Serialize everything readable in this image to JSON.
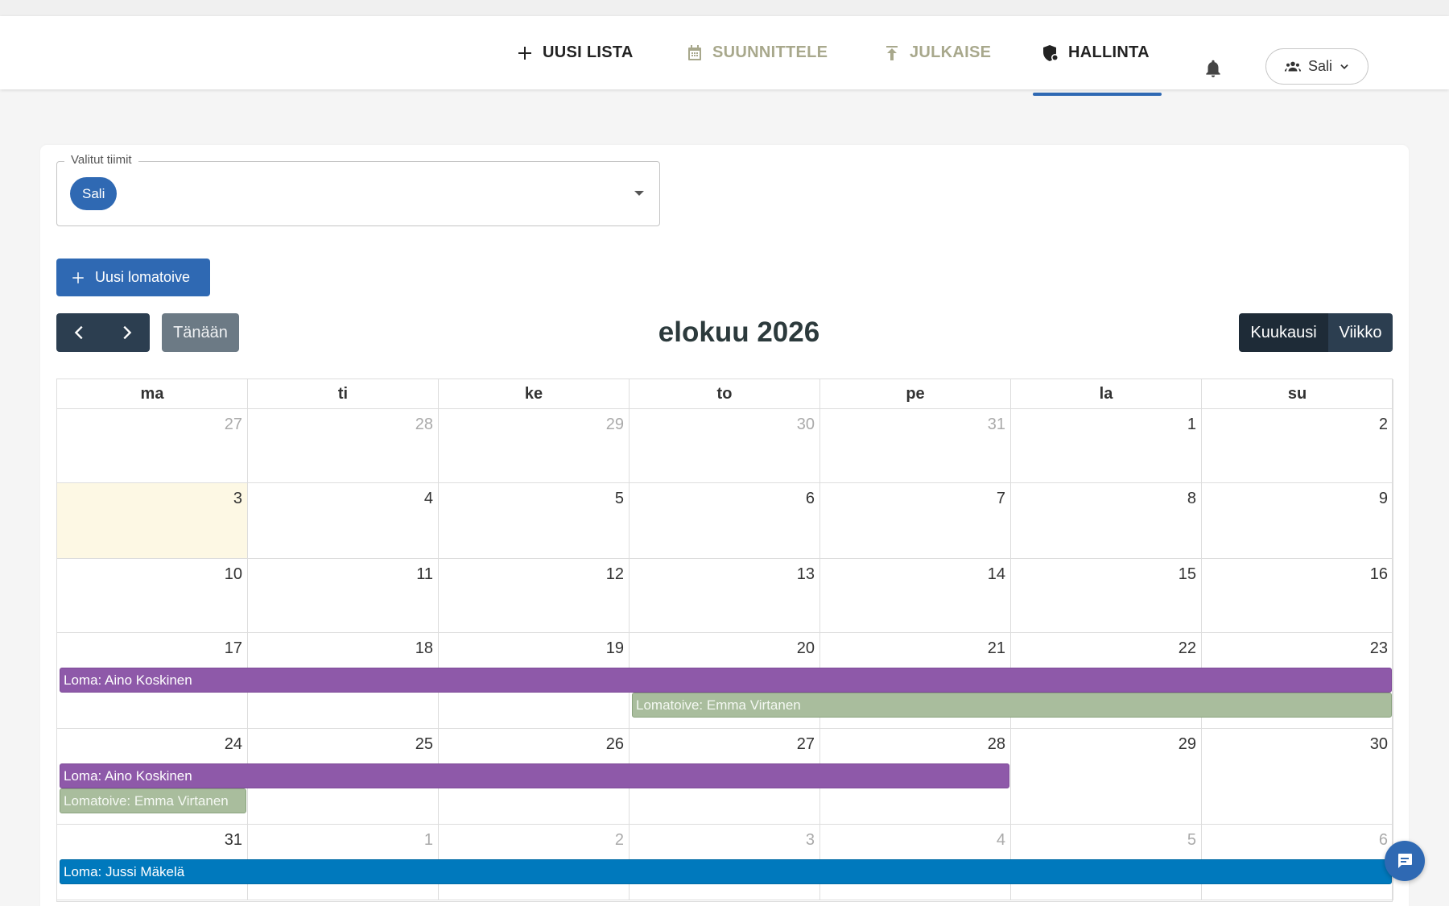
{
  "nav": {
    "new_list": "UUSI LISTA",
    "plan": "SUUNNITTELE",
    "publish": "JULKAISE",
    "admin": "HALLINTA",
    "active": "HALLINTA",
    "user": "Sali"
  },
  "team_select": {
    "legend": "Valitut tiimit",
    "chips": [
      "Sali"
    ]
  },
  "new_leave_button": "Uusi lomatoive",
  "toolbar": {
    "today": "Tänään",
    "title": "elokuu 2026",
    "view_month": "Kuukausi",
    "view_week": "Viikko",
    "active_view": "Kuukausi"
  },
  "calendar": {
    "weekdays": [
      "ma",
      "ti",
      "ke",
      "to",
      "pe",
      "la",
      "su"
    ],
    "today_date": "3",
    "weeks": [
      [
        {
          "d": "27",
          "other": true
        },
        {
          "d": "28",
          "other": true
        },
        {
          "d": "29",
          "other": true
        },
        {
          "d": "30",
          "other": true
        },
        {
          "d": "31",
          "other": true
        },
        {
          "d": "1"
        },
        {
          "d": "2"
        }
      ],
      [
        {
          "d": "3",
          "today": true
        },
        {
          "d": "4"
        },
        {
          "d": "5"
        },
        {
          "d": "6"
        },
        {
          "d": "7"
        },
        {
          "d": "8"
        },
        {
          "d": "9"
        }
      ],
      [
        {
          "d": "10"
        },
        {
          "d": "11"
        },
        {
          "d": "12"
        },
        {
          "d": "13"
        },
        {
          "d": "14"
        },
        {
          "d": "15"
        },
        {
          "d": "16"
        }
      ],
      [
        {
          "d": "17"
        },
        {
          "d": "18"
        },
        {
          "d": "19"
        },
        {
          "d": "20"
        },
        {
          "d": "21"
        },
        {
          "d": "22"
        },
        {
          "d": "23"
        }
      ],
      [
        {
          "d": "24"
        },
        {
          "d": "25"
        },
        {
          "d": "26"
        },
        {
          "d": "27"
        },
        {
          "d": "28"
        },
        {
          "d": "29"
        },
        {
          "d": "30"
        }
      ],
      [
        {
          "d": "31"
        },
        {
          "d": "1",
          "other": true
        },
        {
          "d": "2",
          "other": true
        },
        {
          "d": "3",
          "other": true
        },
        {
          "d": "4",
          "other": true
        },
        {
          "d": "5",
          "other": true
        },
        {
          "d": "6",
          "other": true
        }
      ]
    ],
    "events": [
      {
        "label": "Loma: Aino Koskinen",
        "type": "loma",
        "color": "#8e59a9",
        "week": 3,
        "start": 0,
        "end": 6,
        "lane": 0
      },
      {
        "label": "Lomatoive: Emma Virtanen",
        "type": "lomatoive",
        "color": "#a9bd9d",
        "week": 3,
        "start": 3,
        "end": 6,
        "lane": 1
      },
      {
        "label": "Loma: Aino Koskinen",
        "type": "loma",
        "color": "#8e59a9",
        "week": 4,
        "start": 0,
        "end": 4,
        "lane": 0
      },
      {
        "label": "Lomatoive: Emma Virtanen",
        "type": "lomatoive",
        "color": "#a9bd9d",
        "week": 4,
        "start": 0,
        "end": 0,
        "lane": 1
      },
      {
        "label": "Loma: Jussi Mäkelä",
        "type": "loma",
        "color": "#0079bd",
        "week": 5,
        "start": 0,
        "end": 6,
        "lane": 0
      }
    ]
  },
  "colors": {
    "accent": "#2f69b3",
    "nav_dark": "#2c3e50",
    "today_bg": "#fdf8e4"
  }
}
